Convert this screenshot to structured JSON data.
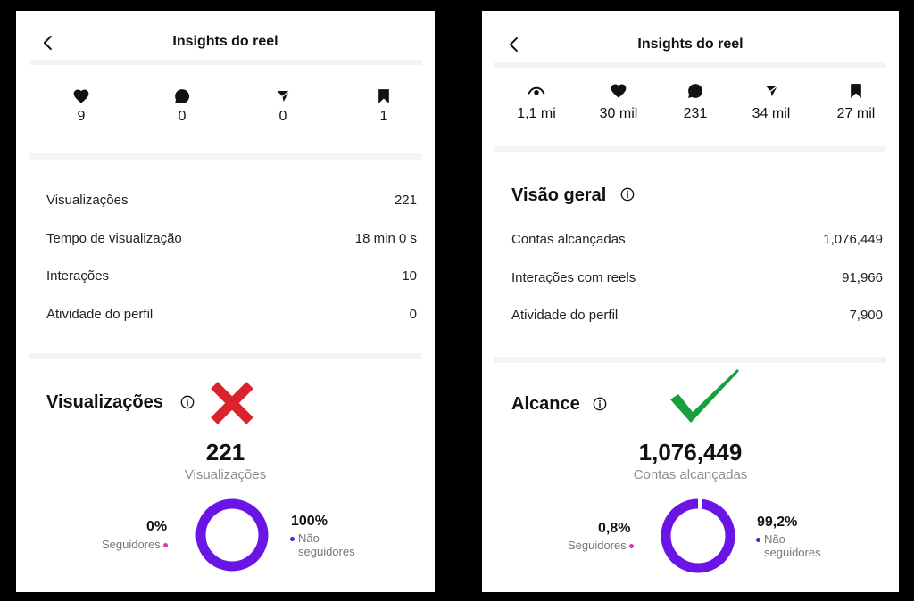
{
  "colors": {
    "accent": "#6a14e6",
    "followers_dot": "#d63ab0",
    "non_followers_dot": "#5b1bd6",
    "cross": "#d9242e",
    "check": "#14a03c",
    "bg": "#000000",
    "panel": "#ffffff"
  },
  "left": {
    "header": {
      "title": "Insights do reel",
      "back_icon": "chevron-left-icon"
    },
    "stats": [
      {
        "icon": "heart-icon",
        "value": "9"
      },
      {
        "icon": "comment-icon",
        "value": "0"
      },
      {
        "icon": "send-icon",
        "value": "0"
      },
      {
        "icon": "bookmark-icon",
        "value": "1"
      }
    ],
    "rows": [
      {
        "label": "Visualizações",
        "value": "221"
      },
      {
        "label": "Tempo de visualização",
        "value": "18 min 0 s"
      },
      {
        "label": "Interações",
        "value": "10"
      },
      {
        "label": "Atividade do perfil",
        "value": "0"
      }
    ],
    "section": {
      "title": "Visualizações",
      "big_number": "221",
      "big_label": "Visualizações",
      "marker": "cross-icon"
    },
    "donut": {
      "followers_pct": "0%",
      "followers_label": "Seguidores",
      "non_followers_pct": "100%",
      "non_followers_label_1": "Não",
      "non_followers_label_2": "seguidores",
      "followers_fraction": 0.0
    }
  },
  "right": {
    "header": {
      "title": "Insights do reel",
      "back_icon": "chevron-left-icon"
    },
    "stats": [
      {
        "icon": "eye-icon",
        "value": "1,1 mi"
      },
      {
        "icon": "heart-icon",
        "value": "30 mil"
      },
      {
        "icon": "comment-icon",
        "value": "231"
      },
      {
        "icon": "send-icon",
        "value": "34 mil"
      },
      {
        "icon": "bookmark-icon",
        "value": "27 mil"
      }
    ],
    "overview_title": "Visão geral",
    "rows": [
      {
        "label": "Contas alcançadas",
        "value": "1,076,449"
      },
      {
        "label": "Interações com reels",
        "value": "91,966"
      },
      {
        "label": "Atividade do perfil",
        "value": "7,900"
      }
    ],
    "section": {
      "title": "Alcance",
      "big_number": "1,076,449",
      "big_label": "Contas alcançadas",
      "marker": "check-icon"
    },
    "donut": {
      "followers_pct": "0,8%",
      "followers_label": "Seguidores",
      "non_followers_pct": "99,2%",
      "non_followers_label_1": "Não",
      "non_followers_label_2": "seguidores",
      "followers_fraction": 0.008
    }
  }
}
